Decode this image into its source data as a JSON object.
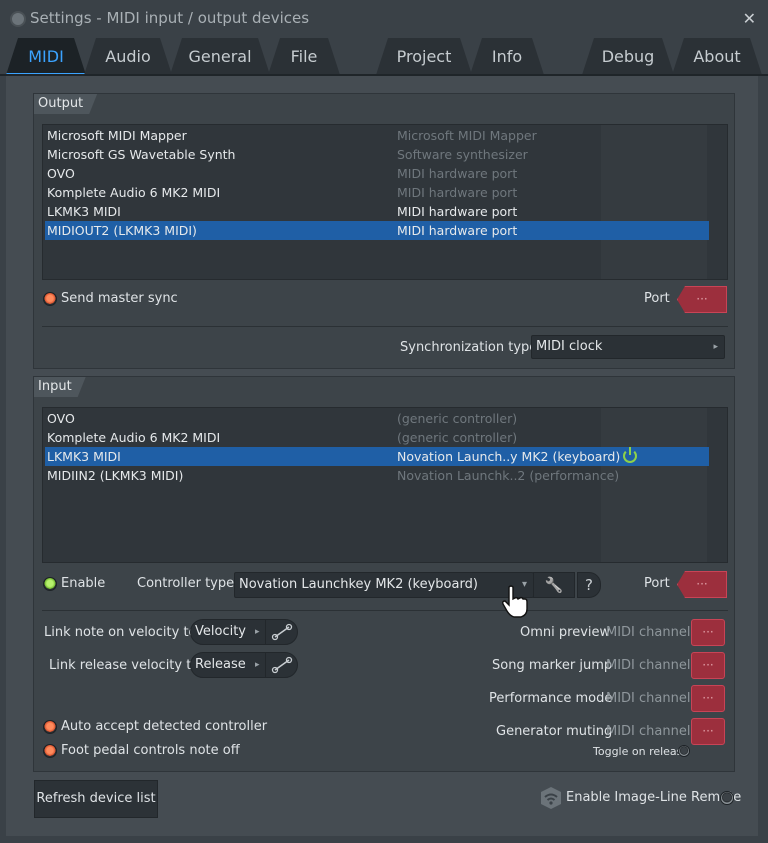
{
  "window": {
    "title": "Settings - MIDI input / output devices",
    "close_glyph": "✕"
  },
  "tabs": [
    {
      "label": "MIDI",
      "active": true
    },
    {
      "label": "Audio"
    },
    {
      "label": "General"
    },
    {
      "label": "File"
    },
    {
      "label": "Project"
    },
    {
      "label": "Info"
    },
    {
      "label": "Debug"
    },
    {
      "label": "About"
    }
  ],
  "output": {
    "label": "Output",
    "devices": [
      {
        "name": "Microsoft MIDI Mapper",
        "desc": "Microsoft MIDI Mapper"
      },
      {
        "name": "Microsoft GS Wavetable Synth",
        "desc": "Software synthesizer"
      },
      {
        "name": "OVO",
        "desc": "MIDI hardware port"
      },
      {
        "name": "Komplete Audio 6 MK2 MIDI",
        "desc": "MIDI hardware port"
      },
      {
        "name": "LKMK3 MIDI",
        "desc": "MIDI hardware port"
      },
      {
        "name": "MIDIOUT2 (LKMK3 MIDI)",
        "desc": "MIDI hardware port",
        "selected": true
      }
    ],
    "send_master_sync": "Send master sync",
    "port_label": "Port",
    "port_value": "···",
    "sync_type_label": "Synchronization type",
    "sync_type_value": "MIDI clock",
    "dropdown_arrow": "▸"
  },
  "input": {
    "label": "Input",
    "devices": [
      {
        "name": "OVO",
        "desc": "(generic controller)"
      },
      {
        "name": "Komplete Audio 6 MK2 MIDI",
        "desc": "(generic controller)"
      },
      {
        "name": "LKMK3 MIDI",
        "desc": "Novation Launch..y MK2 (keyboard)",
        "selected": true,
        "power": true
      },
      {
        "name": "MIDIIN2 (LKMK3 MIDI)",
        "desc": "Novation Launchk..2 (performance)"
      }
    ],
    "enable_label": "Enable",
    "controller_type_label": "Controller type",
    "controller_type_value": "Novation Launchkey MK2 (keyboard)",
    "controller_arrow": "▾",
    "wrench_glyph": "🔧",
    "help_glyph": "?",
    "port_label": "Port",
    "port_value": "···",
    "link_note_label": "Link note on velocity to",
    "link_note_value": "Velocity",
    "link_release_label": "Link release velocity to",
    "link_release_value": "Release",
    "pill_arrow": "▸",
    "auto_accept_label": "Auto accept detected controller",
    "foot_pedal_label": "Foot pedal controls note off",
    "channels": [
      {
        "label": "Omni preview",
        "suffix": "MIDI channel",
        "value": "···"
      },
      {
        "label": "Song marker jump",
        "suffix": "MIDI channel",
        "value": "···"
      },
      {
        "label": "Performance mode",
        "suffix": "MIDI channel",
        "value": "···"
      },
      {
        "label": "Generator muting",
        "suffix": "MIDI channel",
        "value": "···"
      }
    ],
    "toggle_on_release": "Toggle on release"
  },
  "footer": {
    "refresh_label": "Refresh device list",
    "remote_label": "Enable Image-Line Remote"
  },
  "colors": {
    "accent": "#3ba3ff",
    "selection": "#1f5fa6",
    "port_button": "#9c2f3d",
    "led_orange": "#d6502c",
    "led_green": "#6db42a"
  }
}
